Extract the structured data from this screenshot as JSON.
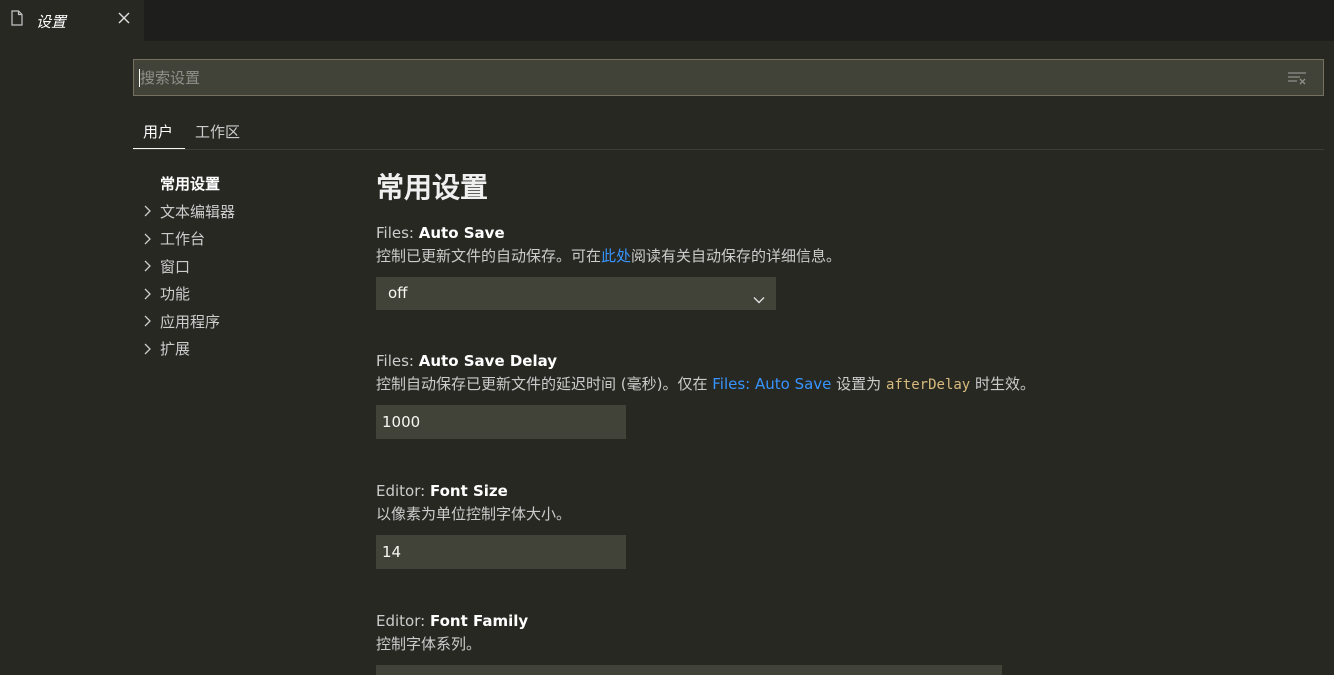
{
  "tab": {
    "title": "设置"
  },
  "search": {
    "placeholder": "搜索设置",
    "value": ""
  },
  "scopes": {
    "user": "用户",
    "workspace": "工作区"
  },
  "toc": {
    "header": "常用设置",
    "items": [
      "文本编辑器",
      "工作台",
      "窗口",
      "功能",
      "应用程序",
      "扩展"
    ]
  },
  "main": {
    "section_title": "常用设置",
    "autosave": {
      "category": "Files: ",
      "name": "Auto Save",
      "desc_before": "控制已更新文件的自动保存。可在",
      "desc_link": "此处",
      "desc_after": "阅读有关自动保存的详细信息。",
      "value": "off"
    },
    "autosave_delay": {
      "category": "Files: ",
      "name": "Auto Save Delay",
      "desc_before": "控制自动保存已更新文件的延迟时间 (毫秒)。仅在 ",
      "desc_link": "Files: Auto Save",
      "desc_mid": " 设置为 ",
      "desc_code": "afterDelay",
      "desc_after": " 时生效。",
      "value": "1000"
    },
    "font_size": {
      "category": "Editor: ",
      "name": "Font Size",
      "desc": "以像素为单位控制字体大小。",
      "value": "14"
    },
    "font_family": {
      "category": "Editor: ",
      "name": "Font Family",
      "desc": "控制字体系列。"
    }
  },
  "colors": {
    "background": "#272822",
    "tabbar": "#1e1f1c",
    "input": "#414339",
    "link": "#3794ff",
    "code": "#d7ba7d"
  },
  "icons": {
    "tab": "file-icon",
    "close": "close-icon",
    "clear": "clear-filter-icon",
    "toc_chevron": "chevron-right-icon",
    "select": "chevron-down-icon"
  }
}
